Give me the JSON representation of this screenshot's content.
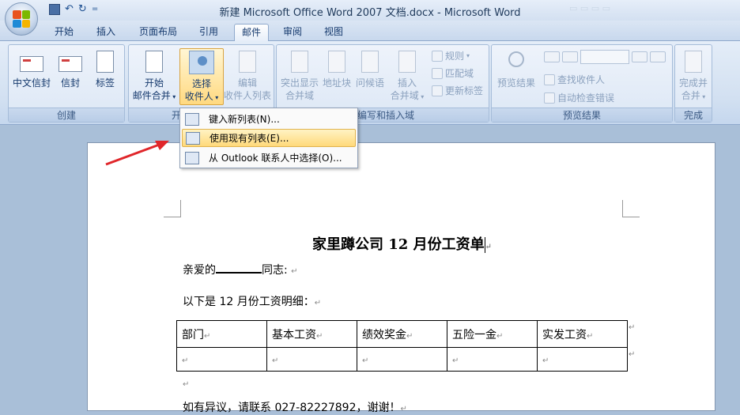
{
  "window": {
    "title": "新建 Microsoft Office Word 2007 文档.docx - Microsoft Word"
  },
  "quick_access": {
    "undo_symbol": "↶",
    "redo_symbol": "↻",
    "more_symbol": "="
  },
  "tabs": [
    {
      "label": "开始"
    },
    {
      "label": "插入"
    },
    {
      "label": "页面布局"
    },
    {
      "label": "引用"
    },
    {
      "label": "邮件",
      "active": true
    },
    {
      "label": "审阅"
    },
    {
      "label": "视图"
    }
  ],
  "ribbon": {
    "create": {
      "label": "创建",
      "chinese_envelope": "中文信封",
      "envelope": "信封",
      "labels": "标签"
    },
    "start_merge": {
      "label": "开",
      "start_line1": "开始",
      "start_line2": "邮件合并",
      "select_line1": "选择",
      "select_line2": "收件人",
      "edit_line1": "编辑",
      "edit_line2": "收件人列表"
    },
    "write_insert": {
      "label": "编写和插入域",
      "highlight_line1": "突出显示",
      "highlight_line2": "合并域",
      "address_block": "地址块",
      "greeting": "问候语",
      "insert_line1": "插入",
      "insert_line2": "合并域",
      "rules": "规则",
      "match_fields": "匹配域",
      "update_labels": "更新标签"
    },
    "preview": {
      "label": "预览结果",
      "preview_results": "预览结果",
      "find_recipient": "查找收件人",
      "auto_check": "自动检查错误"
    },
    "finish": {
      "label": "完成",
      "finish_line1": "完成并",
      "finish_line2": "合并"
    }
  },
  "dropdown_menu": {
    "items": [
      {
        "label": "键入新列表(N)..."
      },
      {
        "label": "使用现有列表(E)...",
        "highlighted": true
      },
      {
        "label": "从 Outlook 联系人中选择(O)..."
      }
    ]
  },
  "document": {
    "title": "家里蹲公司 12 月份工资单",
    "greeting_before": "亲爱的",
    "greeting_after": "同志:",
    "intro": "以下是 12 月份工资明细：",
    "table_headers": [
      "部门",
      "基本工资",
      "绩效奖金",
      "五险一金",
      "实发工资"
    ],
    "footer_text": "如有异议，请联系 027-82227892，谢谢！"
  },
  "colors": {
    "accent_arrow": "#e0262a",
    "menu_highlight": "#ffd97a"
  }
}
